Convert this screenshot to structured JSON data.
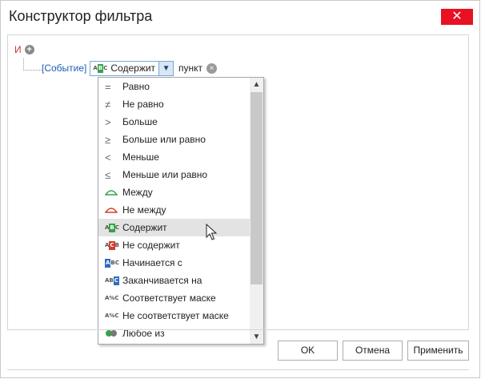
{
  "window": {
    "title": "Конструктор фильтра",
    "close": "✕"
  },
  "filter": {
    "group_label": "И",
    "add_glyph": "+",
    "field": "[Событие]",
    "operator_label": "Содержит",
    "operator_icon": "abc-contains",
    "value": "пункт",
    "remove_glyph": "×"
  },
  "dropdown": {
    "items": [
      {
        "label": "Равно",
        "icon": "equals-icon"
      },
      {
        "label": "Не равно",
        "icon": "not-equals-icon"
      },
      {
        "label": "Больше",
        "icon": "greater-icon"
      },
      {
        "label": "Больше или равно",
        "icon": "greater-or-equal-icon"
      },
      {
        "label": "Меньше",
        "icon": "less-icon"
      },
      {
        "label": "Меньше или равно",
        "icon": "less-or-equal-icon"
      },
      {
        "label": "Между",
        "icon": "between-icon"
      },
      {
        "label": "Не между",
        "icon": "not-between-icon"
      },
      {
        "label": "Содержит",
        "icon": "contains-icon"
      },
      {
        "label": "Не содержит",
        "icon": "not-contains-icon"
      },
      {
        "label": "Начинается с",
        "icon": "begins-with-icon"
      },
      {
        "label": "Заканчивается на",
        "icon": "ends-with-icon"
      },
      {
        "label": "Соответствует маске",
        "icon": "like-icon"
      },
      {
        "label": "Не соответствует маске",
        "icon": "not-like-icon"
      },
      {
        "label": "Любое из",
        "icon": "any-of-icon"
      }
    ],
    "selected": "Содержит"
  },
  "buttons": {
    "ok": "OK",
    "cancel": "Отмена",
    "apply": "Применить"
  },
  "colors": {
    "accent": "#1c5fb5",
    "close": "#e81123",
    "and": "#d0362b",
    "selected_row": "#e3e3e3"
  }
}
